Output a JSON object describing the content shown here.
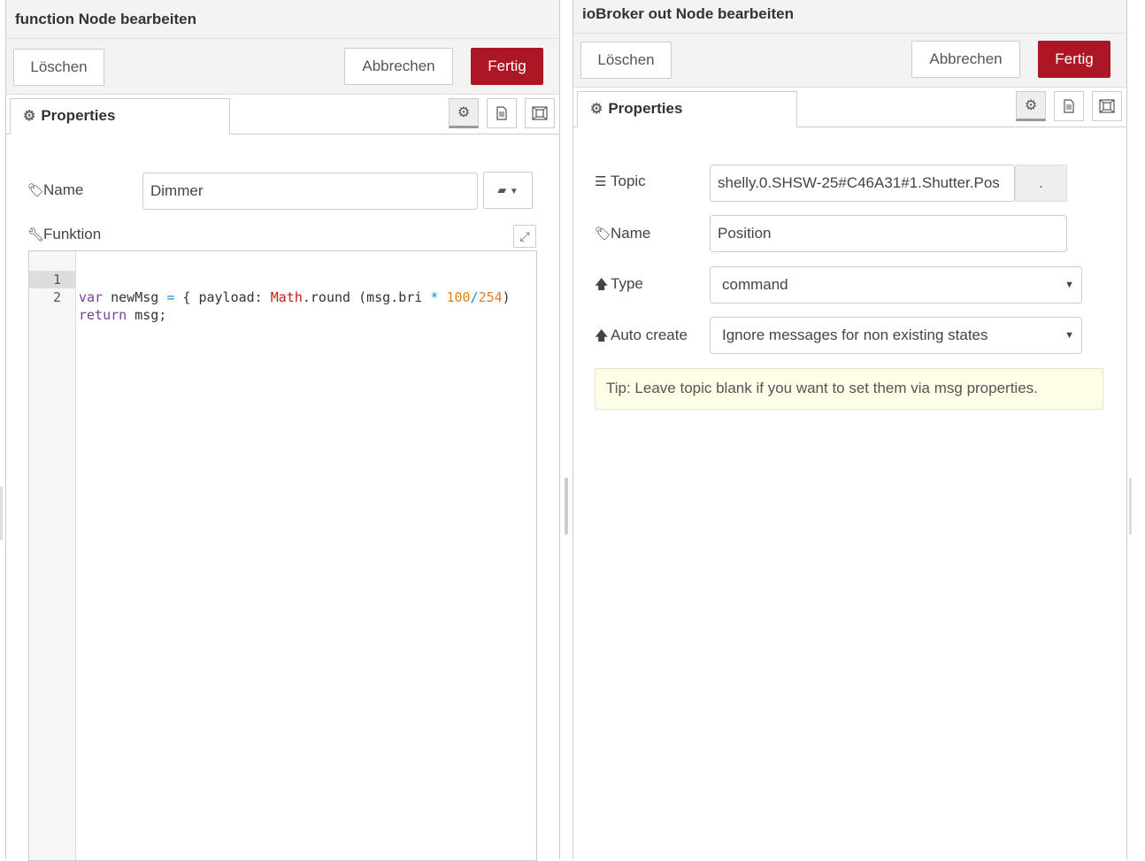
{
  "function_node": {
    "title": "function Node bearbeiten",
    "delete_label": "Löschen",
    "cancel_label": "Abbrechen",
    "done_label": "Fertig",
    "tab_label": "Properties",
    "name_label": "Name",
    "name_value": "Dimmer",
    "function_label": "Funktion",
    "code_lines": [
      {
        "number": "1"
      },
      {
        "number": "2"
      }
    ],
    "code": {
      "l1_var": "var",
      "l1_a": " newMsg ",
      "l1_eq": "=",
      "l1_b": " { payload: ",
      "l1_math": "Math",
      "l1_c": ".round (msg.bri ",
      "l1_star": "*",
      "l1_d": " ",
      "l1_n1": "100",
      "l1_slash": "/",
      "l1_n2": "254",
      "l1_e": ")",
      "l2_return": "return",
      "l2_a": " msg;"
    }
  },
  "iobroker_node": {
    "title": "ioBroker out Node bearbeiten",
    "delete_label": "Löschen",
    "cancel_label": "Abbrechen",
    "done_label": "Fertig",
    "tab_label": "Properties",
    "topic_label": "Topic",
    "topic_value": "shelly.0.SHSW-25#C46A31#1.Shutter.Pos",
    "topic_button": ".",
    "name_label": "Name",
    "name_value": "Position",
    "type_label": "Type",
    "type_value": "command",
    "autocreate_label": "Auto create",
    "autocreate_value": "Ignore messages for non existing states",
    "tip": "Tip: Leave topic blank if you want to set them via msg properties."
  },
  "colors": {
    "primary": "#ad1625",
    "keyword": "#7a3e9d",
    "number": "#e67e22",
    "class": "#c41a16",
    "operator": "#1e90c8",
    "tip_bg": "#fdfde8"
  },
  "icons": [
    "gear-icon",
    "book-icon",
    "description-icon",
    "appearance-icon",
    "tag-icon",
    "wrench-icon",
    "expand-icon",
    "list-icon",
    "arrow-up-icon",
    "chevron-down-icon"
  ]
}
